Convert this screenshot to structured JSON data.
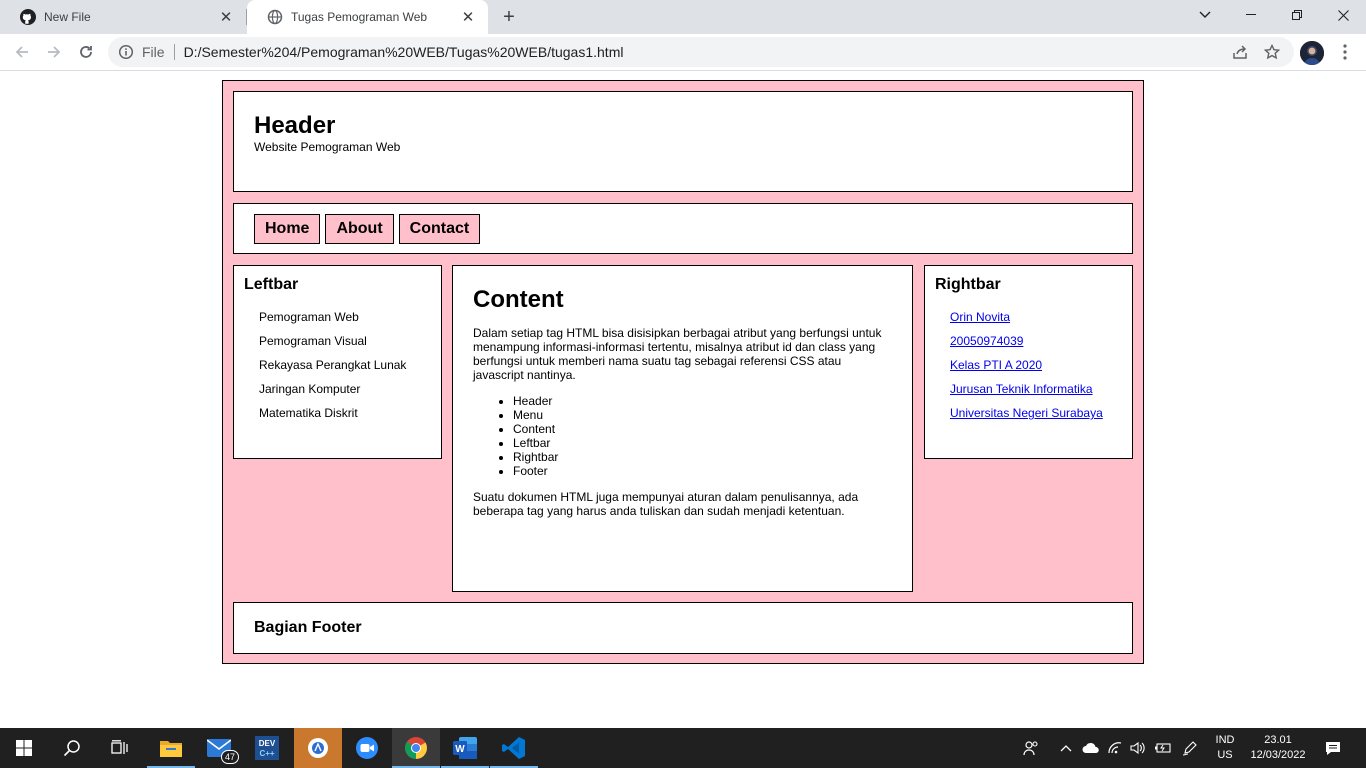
{
  "browser": {
    "tabs": [
      {
        "title": "New File",
        "icon": "github-icon",
        "active": false
      },
      {
        "title": "Tugas Pemograman Web",
        "icon": "globe-icon",
        "active": true
      }
    ],
    "address": {
      "scheme": "File",
      "url": "D:/Semester%204/Pemograman%20WEB/Tugas%20WEB/tugas1.html"
    }
  },
  "page": {
    "header": {
      "title": "Header",
      "subtitle": "Website Pemograman Web"
    },
    "menu": [
      {
        "label": "Home"
      },
      {
        "label": "About"
      },
      {
        "label": "Contact"
      }
    ],
    "leftbar": {
      "title": "Leftbar",
      "items": [
        "Pemograman Web",
        "Pemograman Visual",
        "Rekayasa Perangkat Lunak",
        "Jaringan Komputer",
        "Matematika Diskrit"
      ]
    },
    "content": {
      "title": "Content",
      "paragraph1": "Dalam setiap tag HTML bisa disisipkan berbagai atribut yang berfungsi untuk menampung informasi-informasi tertentu, misalnya atribut id dan class yang berfungsi untuk memberi nama suatu tag sebagai referensi CSS atau javascript nantinya.",
      "list": [
        "Header",
        "Menu",
        "Content",
        "Leftbar",
        "Rightbar",
        "Footer"
      ],
      "paragraph2": "Suatu dokumen HTML juga mempunyai aturan dalam penulisannya, ada beberapa tag yang harus anda tuliskan dan sudah menjadi ketentuan."
    },
    "rightbar": {
      "title": "Rightbar",
      "links": [
        "Orin Novita",
        "20050974039",
        "Kelas PTI A 2020",
        "Jurusan Teknik Informatika",
        "Universitas Negeri Surabaya"
      ]
    },
    "footer": {
      "title": "Bagian Footer"
    },
    "colors": {
      "page_background": "#ffc0cb",
      "link": "#0000ee"
    }
  },
  "taskbar": {
    "mail_badge": "47",
    "language_top": "IND",
    "language_bottom": "US",
    "time": "23.01",
    "date": "12/03/2022"
  }
}
